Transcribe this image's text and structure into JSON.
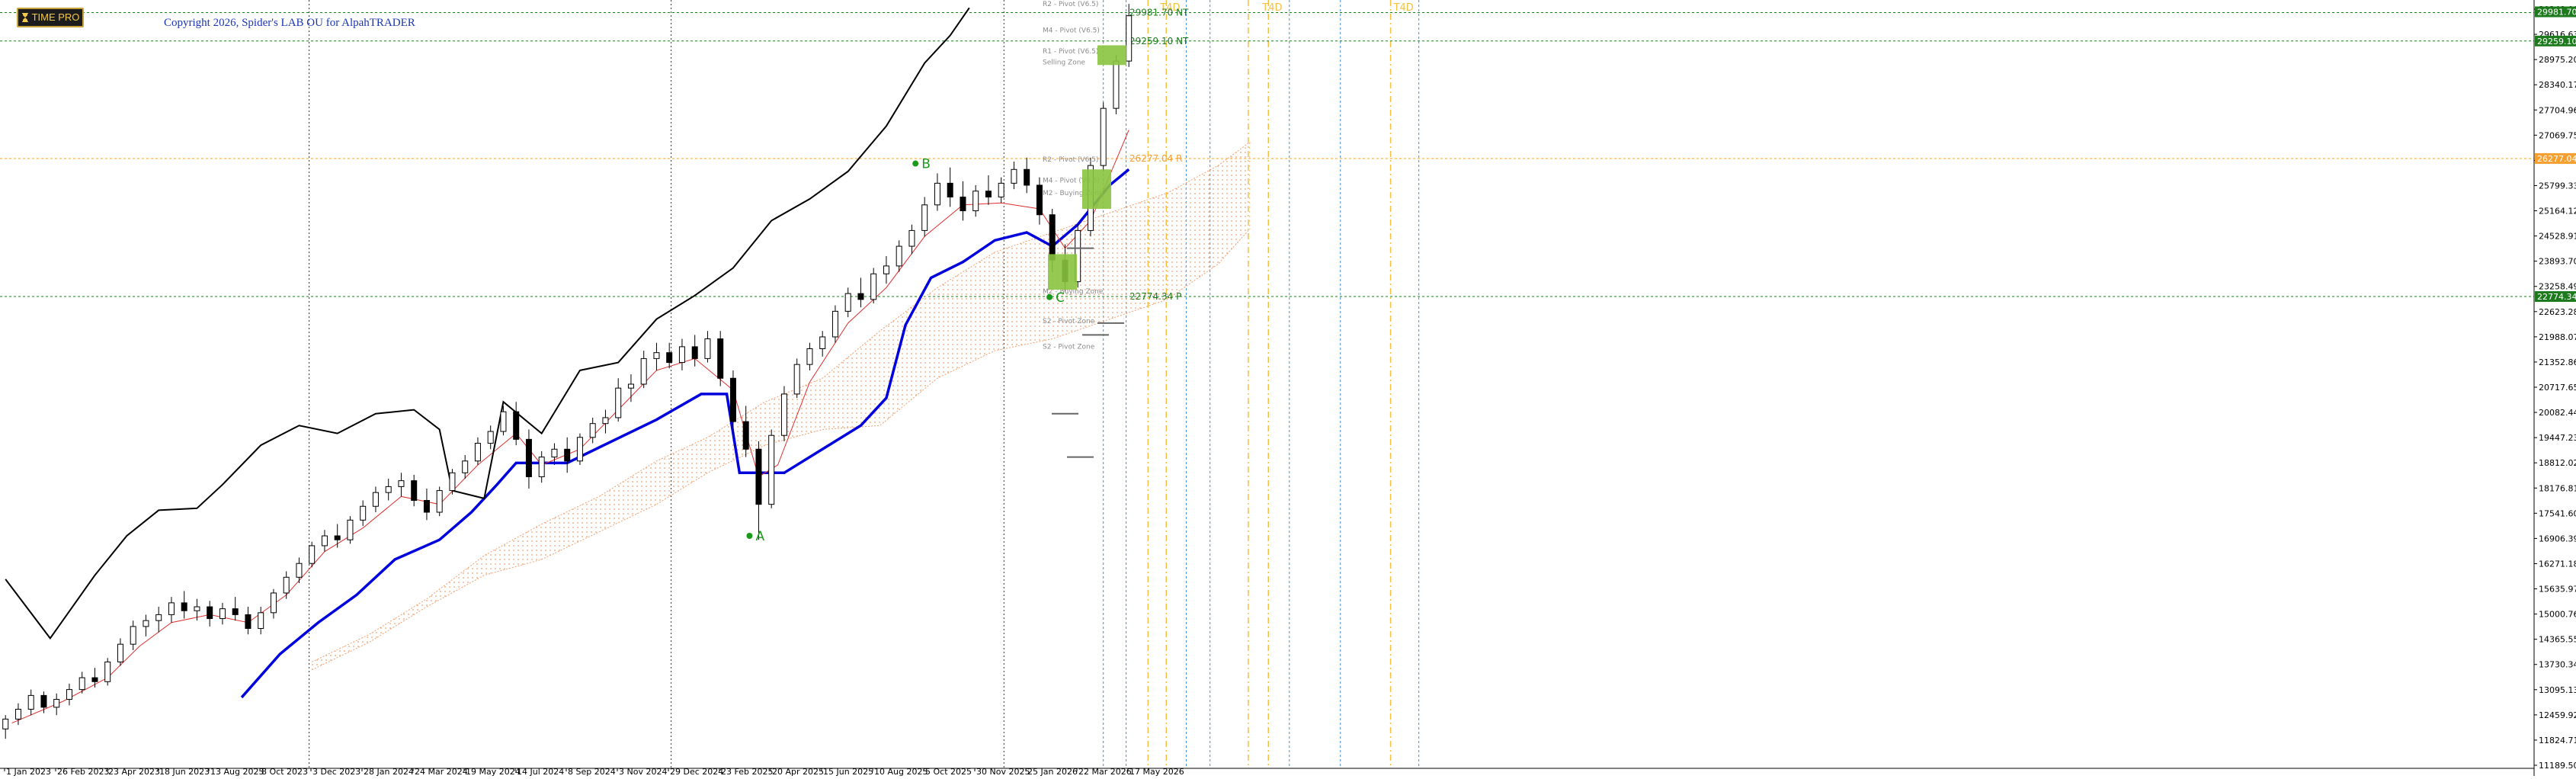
{
  "ui": {
    "time_pro_label": "TIME PRO",
    "copyright": "Copyright 2026, Spider's LAB OU for AlpahTRADER"
  },
  "colors": {
    "candle_up": "#ffffff",
    "candle_down": "#000000",
    "kijun": "#0000dd",
    "tenkan": "#e03030",
    "chikou": "#000000",
    "cloud": "#f2a070",
    "green_level": "#1a9a1a",
    "orange_level": "#f5a030",
    "zone_fill": "#8ac43f",
    "price_tag": "#1d7a1d"
  },
  "chart_data": {
    "type": "candlestick",
    "title": "",
    "ylim": [
      10800,
      30300
    ],
    "grid": false,
    "x_labels": [
      "1 Jan 2023",
      "26 Feb 2023",
      "23 Apr 2023",
      "18 Jun 2023",
      "13 Aug 2023",
      "8 Oct 2023",
      "3 Dec 2023",
      "28 Jan 2024",
      "24 Mar 2024",
      "19 May 2024",
      "14 Jul 2024",
      "8 Sep 2024",
      "3 Nov 2024",
      "29 Dec 2024",
      "23 Feb 2025",
      "20 Apr 2025",
      "15 Jun 2025",
      "10 Aug 2025",
      "5 Oct 2025",
      "30 Nov 2025",
      "25 Jan 2026",
      "22 Mar 2026",
      "17 May 2026"
    ],
    "y_ticks": [
      "30248.00",
      "29616.63",
      "28975.20",
      "28340.17",
      "27704.96",
      "27069.75",
      "26434.54",
      "25799.33",
      "25164.12",
      "24528.91",
      "23893.70",
      "23258.49",
      "22623.28",
      "21988.07",
      "21352.86",
      "20717.65",
      "20082.44",
      "19447.23",
      "18812.02",
      "18176.81",
      "17541.60",
      "16906.39",
      "16271.18",
      "15635.97",
      "15000.76",
      "14365.55",
      "13730.34",
      "13095.13",
      "12459.92",
      "11824.71",
      "11189.50"
    ],
    "price_tags": [
      {
        "label": "29981.70",
        "value": 30000,
        "color": "#1d7a1d"
      },
      {
        "label": "29259.10",
        "value": 29259,
        "color": "#1d7a1d"
      },
      {
        "label": "26277.04",
        "value": 26277,
        "color": "#f5a030"
      },
      {
        "label": "22774.34",
        "value": 22774,
        "color": "#1d7a1d"
      }
    ],
    "levels": [
      {
        "value": 29981.7,
        "label": "29981.70 NT",
        "color": "#1d7a1d"
      },
      {
        "value": 29259.1,
        "label": "29259.10 NT",
        "color": "#1d7a1d"
      },
      {
        "value": 26277.04,
        "label": "26277.04 R",
        "color": "#f5a030"
      },
      {
        "value": 22774.34,
        "label": "22774.34 P",
        "color": "#1d7a1d"
      }
    ],
    "points": [
      {
        "label": "A",
        "date": "2025-04-07",
        "value": 16700
      },
      {
        "label": "B",
        "date": "2025-10-06",
        "value": 26150
      },
      {
        "label": "C",
        "date": "2026-03-02",
        "value": 22760
      }
    ],
    "pivot_labels": [
      {
        "label": "R2 - Pivot (V6.5)",
        "value": 30150
      },
      {
        "label": "M4 - Pivot (V6.5)",
        "value": 29480
      },
      {
        "label": "R1 - Pivot (V6.5)",
        "value": 28950
      },
      {
        "label": "Selling Zone",
        "value": 28670
      },
      {
        "label": "R2 - Pivot (V6.5)",
        "value": 26200
      },
      {
        "label": "M4 - Pivot (V6.5)",
        "value": 25670
      },
      {
        "label": "M2 - Buying Zone",
        "value": 25350
      },
      {
        "label": "M2 - Buying Zone",
        "value": 22850
      },
      {
        "label": "S2 - Pivot Zone",
        "value": 22100
      },
      {
        "label": "S2 - Pivot Zone",
        "value": 21450
      }
    ],
    "vlines_black": [
      "2023-12-01",
      "2025-01-01",
      "2026-01-01"
    ],
    "vlines_blue": [
      "2026-04-20",
      "2026-05-15",
      "2026-07-20",
      "2026-08-15",
      "2026-11-10",
      "2027-01-05",
      "2027-04-01"
    ],
    "vlines_orange": [
      "2026-06-08",
      "2026-06-28",
      "2026-09-26",
      "2026-10-18",
      "2027-03-01"
    ],
    "time_markers": [
      {
        "label": "T4D",
        "date": "2026-06-18"
      },
      {
        "label": "T4D",
        "date": "2026-10-08"
      },
      {
        "label": "T4D",
        "date": "2027-03-01"
      }
    ],
    "candles": [
      [
        "2023-01-02",
        11800,
        12150,
        11550,
        12050
      ],
      [
        "2023-01-16",
        12050,
        12450,
        11900,
        12300
      ],
      [
        "2023-01-30",
        12300,
        12800,
        12150,
        12650
      ],
      [
        "2023-02-13",
        12650,
        12750,
        12200,
        12350
      ],
      [
        "2023-02-27",
        12350,
        12700,
        12150,
        12550
      ],
      [
        "2023-03-13",
        12550,
        12950,
        12400,
        12800
      ],
      [
        "2023-03-27",
        12800,
        13250,
        12700,
        13100
      ],
      [
        "2023-04-10",
        13100,
        13350,
        12850,
        13000
      ],
      [
        "2023-04-24",
        13000,
        13600,
        12900,
        13500
      ],
      [
        "2023-05-08",
        13500,
        14100,
        13400,
        13950
      ],
      [
        "2023-05-22",
        13950,
        14550,
        13800,
        14400
      ],
      [
        "2023-06-05",
        14400,
        14700,
        14150,
        14550
      ],
      [
        "2023-06-19",
        14550,
        14900,
        14250,
        14700
      ],
      [
        "2023-07-03",
        14700,
        15150,
        14500,
        15000
      ],
      [
        "2023-07-17",
        15000,
        15300,
        14600,
        14800
      ],
      [
        "2023-07-31",
        14800,
        15100,
        14550,
        14900
      ],
      [
        "2023-08-14",
        14900,
        15050,
        14400,
        14600
      ],
      [
        "2023-08-28",
        14600,
        15000,
        14450,
        14850
      ],
      [
        "2023-09-11",
        14850,
        15150,
        14550,
        14700
      ],
      [
        "2023-09-25",
        14700,
        14900,
        14200,
        14350
      ],
      [
        "2023-10-09",
        14350,
        14900,
        14200,
        14750
      ],
      [
        "2023-10-23",
        14750,
        15350,
        14600,
        15250
      ],
      [
        "2023-11-06",
        15250,
        15800,
        15100,
        15650
      ],
      [
        "2023-11-20",
        15650,
        16150,
        15500,
        16000
      ],
      [
        "2023-12-04",
        16000,
        16550,
        15900,
        16450
      ],
      [
        "2023-12-18",
        16450,
        16850,
        16300,
        16700
      ],
      [
        "2024-01-01",
        16700,
        17000,
        16400,
        16600
      ],
      [
        "2024-01-15",
        16600,
        17200,
        16500,
        17100
      ],
      [
        "2024-01-29",
        17100,
        17600,
        16950,
        17450
      ],
      [
        "2024-02-12",
        17450,
        17950,
        17300,
        17800
      ],
      [
        "2024-02-26",
        17800,
        18150,
        17600,
        17950
      ],
      [
        "2024-03-11",
        17950,
        18300,
        17700,
        18100
      ],
      [
        "2024-03-25",
        18100,
        18250,
        17450,
        17600
      ],
      [
        "2024-04-08",
        17600,
        17900,
        17100,
        17300
      ],
      [
        "2024-04-22",
        17300,
        17950,
        17200,
        17850
      ],
      [
        "2024-05-06",
        17850,
        18400,
        17750,
        18300
      ],
      [
        "2024-05-20",
        18300,
        18750,
        18150,
        18600
      ],
      [
        "2024-06-03",
        18600,
        19200,
        18500,
        19050
      ],
      [
        "2024-06-17",
        19050,
        19500,
        18900,
        19350
      ],
      [
        "2024-07-01",
        19350,
        20000,
        19250,
        19850
      ],
      [
        "2024-07-15",
        19850,
        20100,
        19000,
        19150
      ],
      [
        "2024-07-29",
        19150,
        19400,
        17900,
        18200
      ],
      [
        "2024-08-12",
        18200,
        18850,
        18050,
        18700
      ],
      [
        "2024-08-26",
        18700,
        19050,
        18500,
        18900
      ],
      [
        "2024-09-09",
        18900,
        19200,
        18300,
        18600
      ],
      [
        "2024-09-23",
        18600,
        19300,
        18500,
        19200
      ],
      [
        "2024-10-07",
        19200,
        19700,
        19050,
        19550
      ],
      [
        "2024-10-21",
        19550,
        19900,
        19300,
        19700
      ],
      [
        "2024-11-04",
        19700,
        20700,
        19600,
        20450
      ],
      [
        "2024-11-18",
        20450,
        20800,
        20100,
        20550
      ],
      [
        "2024-12-02",
        20550,
        21400,
        20450,
        21200
      ],
      [
        "2024-12-16",
        21200,
        21600,
        20900,
        21350
      ],
      [
        "2024-12-30",
        21350,
        21600,
        20950,
        21100
      ],
      [
        "2025-01-13",
        21100,
        21700,
        20900,
        21500
      ],
      [
        "2025-01-27",
        21500,
        21800,
        21000,
        21200
      ],
      [
        "2025-02-10",
        21200,
        21900,
        21100,
        21700
      ],
      [
        "2025-02-24",
        21700,
        21900,
        20500,
        20700
      ],
      [
        "2025-03-10",
        20700,
        20900,
        19300,
        19600
      ],
      [
        "2025-03-24",
        19600,
        20000,
        18700,
        18900
      ],
      [
        "2025-04-07",
        18900,
        19100,
        16600,
        17500
      ],
      [
        "2025-04-21",
        17500,
        19400,
        17400,
        19250
      ],
      [
        "2025-05-05",
        19250,
        20500,
        19100,
        20300
      ],
      [
        "2025-05-19",
        20300,
        21200,
        20200,
        21050
      ],
      [
        "2025-06-02",
        21050,
        21600,
        20900,
        21450
      ],
      [
        "2025-06-16",
        21450,
        21900,
        21250,
        21750
      ],
      [
        "2025-06-30",
        21750,
        22550,
        21600,
        22400
      ],
      [
        "2025-07-14",
        22400,
        23000,
        22250,
        22850
      ],
      [
        "2025-07-28",
        22850,
        23250,
        22500,
        22700
      ],
      [
        "2025-08-11",
        22700,
        23500,
        22600,
        23350
      ],
      [
        "2025-08-25",
        23350,
        23800,
        23100,
        23550
      ],
      [
        "2025-09-08",
        23550,
        24200,
        23400,
        24050
      ],
      [
        "2025-09-22",
        24050,
        24600,
        23850,
        24450
      ],
      [
        "2025-10-06",
        24450,
        25300,
        24300,
        25100
      ],
      [
        "2025-10-20",
        25100,
        25900,
        24950,
        25650
      ],
      [
        "2025-11-03",
        25650,
        26050,
        25050,
        25300
      ],
      [
        "2025-11-17",
        25300,
        25700,
        24700,
        24950
      ],
      [
        "2025-12-01",
        24950,
        25600,
        24800,
        25450
      ],
      [
        "2025-12-15",
        25450,
        25850,
        25100,
        25300
      ],
      [
        "2025-12-29",
        25300,
        25800,
        25150,
        25650
      ],
      [
        "2026-01-12",
        25650,
        26200,
        25500,
        26000
      ],
      [
        "2026-01-26",
        26000,
        26300,
        25400,
        25600
      ],
      [
        "2026-02-09",
        25600,
        25800,
        24600,
        24850
      ],
      [
        "2026-02-23",
        24850,
        25000,
        23400,
        23700
      ],
      [
        "2026-03-09",
        23700,
        24100,
        22900,
        23150
      ],
      [
        "2026-03-23",
        23150,
        24600,
        23000,
        24450
      ],
      [
        "2026-04-06",
        24450,
        26300,
        24300,
        26100
      ],
      [
        "2026-04-20",
        26100,
        27700,
        25950,
        27550
      ],
      [
        "2026-05-04",
        27550,
        28900,
        27400,
        28750
      ],
      [
        "2026-05-18",
        28750,
        30200,
        28600,
        29900
      ]
    ],
    "kijun": [
      [
        "2023-09-18",
        12600
      ],
      [
        "2023-10-30",
        13700
      ],
      [
        "2023-12-11",
        14500
      ],
      [
        "2024-01-22",
        15200
      ],
      [
        "2024-03-04",
        16100
      ],
      [
        "2024-04-22",
        16600
      ],
      [
        "2024-05-27",
        17300
      ],
      [
        "2024-06-24",
        18000
      ],
      [
        "2024-07-15",
        18550
      ],
      [
        "2024-09-09",
        18550
      ],
      [
        "2024-10-28",
        19100
      ],
      [
        "2024-12-16",
        19650
      ],
      [
        "2025-02-03",
        20300
      ],
      [
        "2025-03-03",
        20300
      ],
      [
        "2025-03-17",
        18300
      ],
      [
        "2025-05-05",
        18300
      ],
      [
        "2025-06-16",
        18900
      ],
      [
        "2025-07-28",
        19500
      ],
      [
        "2025-08-25",
        20200
      ],
      [
        "2025-09-15",
        22050
      ],
      [
        "2025-10-13",
        23250
      ],
      [
        "2025-11-17",
        23650
      ],
      [
        "2025-12-22",
        24200
      ],
      [
        "2026-01-26",
        24400
      ],
      [
        "2026-02-23",
        24050
      ],
      [
        "2026-03-23",
        24600
      ],
      [
        "2026-04-27",
        25600
      ],
      [
        "2026-05-18",
        26000
      ]
    ],
    "tenkan": [
      [
        "2023-01-09",
        11950
      ],
      [
        "2023-03-06",
        12500
      ],
      [
        "2023-04-24",
        13100
      ],
      [
        "2023-05-29",
        13900
      ],
      [
        "2023-07-03",
        14500
      ],
      [
        "2023-08-14",
        14700
      ],
      [
        "2023-09-25",
        14500
      ],
      [
        "2023-11-06",
        15200
      ],
      [
        "2023-12-18",
        16300
      ],
      [
        "2024-01-29",
        16900
      ],
      [
        "2024-03-11",
        17700
      ],
      [
        "2024-04-22",
        17500
      ],
      [
        "2024-06-03",
        18500
      ],
      [
        "2024-07-15",
        19300
      ],
      [
        "2024-08-12",
        18500
      ],
      [
        "2024-09-23",
        18900
      ],
      [
        "2024-11-04",
        19900
      ],
      [
        "2024-12-16",
        20900
      ],
      [
        "2025-01-27",
        21200
      ],
      [
        "2025-03-10",
        20400
      ],
      [
        "2025-04-07",
        18200
      ],
      [
        "2025-04-28",
        18500
      ],
      [
        "2025-06-02",
        20600
      ],
      [
        "2025-07-14",
        22100
      ],
      [
        "2025-08-25",
        23000
      ],
      [
        "2025-10-06",
        24300
      ],
      [
        "2025-11-17",
        25100
      ],
      [
        "2025-12-29",
        25150
      ],
      [
        "2026-02-09",
        25000
      ],
      [
        "2026-03-09",
        24000
      ],
      [
        "2026-04-06",
        24700
      ],
      [
        "2026-05-18",
        27000
      ]
    ],
    "chikou": [
      [
        "2023-01-02",
        15600
      ],
      [
        "2023-02-20",
        14100
      ],
      [
        "2023-04-10",
        15700
      ],
      [
        "2023-05-15",
        16700
      ],
      [
        "2023-06-19",
        17350
      ],
      [
        "2023-07-31",
        17400
      ],
      [
        "2023-08-28",
        18000
      ],
      [
        "2023-10-09",
        19000
      ],
      [
        "2023-11-20",
        19500
      ],
      [
        "2024-01-01",
        19300
      ],
      [
        "2024-02-12",
        19800
      ],
      [
        "2024-03-25",
        19900
      ],
      [
        "2024-04-22",
        19400
      ],
      [
        "2024-05-06",
        17850
      ],
      [
        "2024-06-10",
        17650
      ],
      [
        "2024-07-01",
        20100
      ],
      [
        "2024-08-12",
        19300
      ],
      [
        "2024-09-23",
        20900
      ],
      [
        "2024-11-04",
        21100
      ],
      [
        "2024-12-16",
        22200
      ],
      [
        "2025-01-27",
        22800
      ],
      [
        "2025-03-10",
        23500
      ],
      [
        "2025-04-21",
        24700
      ],
      [
        "2025-06-02",
        25250
      ],
      [
        "2025-07-14",
        25950
      ],
      [
        "2025-08-25",
        27100
      ],
      [
        "2025-10-06",
        28700
      ],
      [
        "2025-11-03",
        29400
      ],
      [
        "2025-11-24",
        30100
      ]
    ],
    "cloud_upper": [
      [
        "2023-12-04",
        13500
      ],
      [
        "2024-02-05",
        14200
      ],
      [
        "2024-04-08",
        15100
      ],
      [
        "2024-06-10",
        16200
      ],
      [
        "2024-08-12",
        17000
      ],
      [
        "2024-10-14",
        17700
      ],
      [
        "2024-12-16",
        18600
      ],
      [
        "2025-02-10",
        19200
      ],
      [
        "2025-04-14",
        20100
      ],
      [
        "2025-06-16",
        20700
      ],
      [
        "2025-08-18",
        21900
      ],
      [
        "2025-10-20",
        23000
      ],
      [
        "2025-12-22",
        23900
      ],
      [
        "2026-02-23",
        24400
      ],
      [
        "2026-04-27",
        24900
      ],
      [
        "2026-06-29",
        25400
      ],
      [
        "2026-08-24",
        26100
      ],
      [
        "2026-09-28",
        26700
      ]
    ],
    "cloud_lower": [
      [
        "2023-12-04",
        13300
      ],
      [
        "2024-02-05",
        14000
      ],
      [
        "2024-04-08",
        14900
      ],
      [
        "2024-06-10",
        15700
      ],
      [
        "2024-08-12",
        16100
      ],
      [
        "2024-10-14",
        16800
      ],
      [
        "2024-12-16",
        17500
      ],
      [
        "2025-02-10",
        18300
      ],
      [
        "2025-04-14",
        19000
      ],
      [
        "2025-06-16",
        19400
      ],
      [
        "2025-08-18",
        19500
      ],
      [
        "2025-10-20",
        20700
      ],
      [
        "2025-12-22",
        21400
      ],
      [
        "2026-02-23",
        21700
      ],
      [
        "2026-04-27",
        22200
      ],
      [
        "2026-06-29",
        22700
      ],
      [
        "2026-08-24",
        23600
      ],
      [
        "2026-09-28",
        24500
      ]
    ]
  }
}
